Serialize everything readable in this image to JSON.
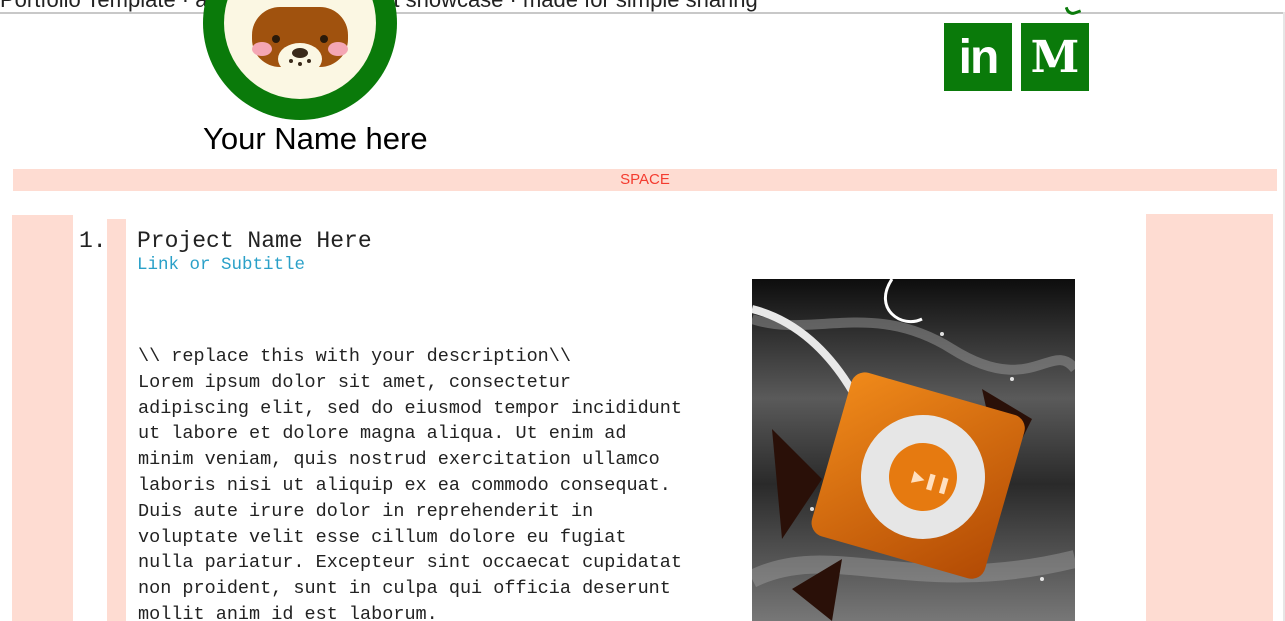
{
  "header": {
    "top_text": "Portfolio Template · a single-page project showcase · made for simple sharing",
    "name": "Your Name here",
    "social": {
      "linkedin_label": "in",
      "medium_label": "M"
    }
  },
  "divider": {
    "label": "SPACE"
  },
  "project": {
    "number": "1.",
    "title": "Project Name Here",
    "subtitle": "Link or Subtitle",
    "description_lines": [
      "\\\\ replace this with your description\\\\",
      "Lorem ipsum dolor sit amet, consectetur",
      "adipiscing elit, sed do eiusmod tempor incididunt",
      "ut labore et dolore magna aliqua. Ut enim ad",
      "minim veniam, quis nostrud exercitation ullamco",
      "laboris nisi ut aliquip ex ea commodo consequat.",
      "Duis aute irure dolor in reprehenderit in",
      "voluptate velit esse cillum dolore eu fugiat",
      "nulla pariatur. Excepteur sint occaecat cupidatat",
      "non proident, sunt in culpa qui officia deserunt",
      "mollit anim id est laborum."
    ]
  },
  "colors": {
    "accent_green": "#0a7a0a",
    "pad_pink": "#fedcd2",
    "space_red": "#f43b2f",
    "link_blue": "#2aa0c8"
  },
  "icons": [
    "avatar-mascot-icon",
    "linkedin-icon",
    "medium-icon"
  ]
}
